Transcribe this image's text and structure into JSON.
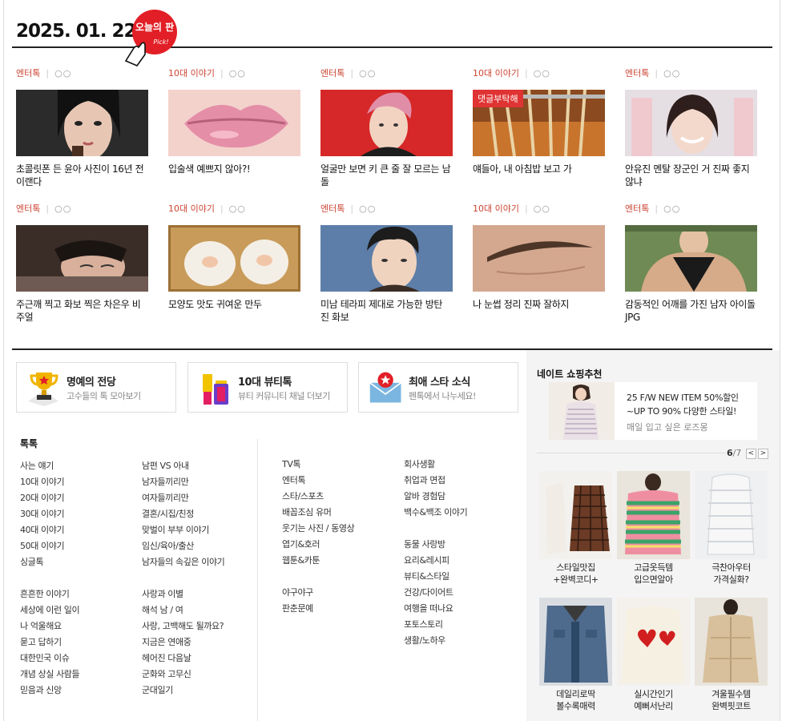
{
  "header": {
    "date": "2025. 01. 22",
    "badge_text": "오늘의 판",
    "badge_sub": "Pick!"
  },
  "cards": [
    {
      "category": "엔터톡",
      "likes": "○○",
      "title": "초콜릿폰 든 윤아 사진이 16년 전이랜다",
      "tag": ""
    },
    {
      "category": "10대 이야기",
      "likes": "○○",
      "title": "입술색 예쁘지 않아?!",
      "tag": ""
    },
    {
      "category": "엔터톡",
      "likes": "○○",
      "title": "얼굴만 보면 키 큰 줄 잘 모르는 남돌",
      "tag": ""
    },
    {
      "category": "10대 이야기",
      "likes": "○○",
      "title": "얘들아, 내 아침밥 보고 가",
      "tag": "댓글부탁해"
    },
    {
      "category": "엔터톡",
      "likes": "○○",
      "title": "안유진 멘탈 장군인 거 진짜 좋지 않냐",
      "tag": ""
    },
    {
      "category": "엔터톡",
      "likes": "○○",
      "title": "주근깨 찍고 화보 찍은 차은우 비주얼",
      "tag": ""
    },
    {
      "category": "10대 이야기",
      "likes": "○○",
      "title": "모양도 맛도 귀여운 만두",
      "tag": ""
    },
    {
      "category": "엔터톡",
      "likes": "○○",
      "title": "미남 테라피 제대로 가능한 방탄 진 화보",
      "tag": ""
    },
    {
      "category": "10대 이야기",
      "likes": "○○",
      "title": "나 눈썹 정리 진짜 잘하지",
      "tag": ""
    },
    {
      "category": "엔터톡",
      "likes": "○○",
      "title": "감동적인 어깨를 가진 남자 아이돌JPG",
      "tag": ""
    }
  ],
  "promos": [
    {
      "title": "명예의 전당",
      "sub": "고수들의 톡 모아보기",
      "icon": "trophy-icon"
    },
    {
      "title": "10대 뷰티톡",
      "sub": "뷰티 커뮤니티 채널 더보기",
      "icon": "cosmetics-icon"
    },
    {
      "title": "최애 스타 소식",
      "sub": "펜톡에서 나누세요!",
      "icon": "star-mail-icon"
    }
  ],
  "talk": {
    "title": "톡톡",
    "col1": [
      "사는 얘기",
      "10대 이야기",
      "20대 이야기",
      "30대 이야기",
      "40대 이야기",
      "50대 이야기",
      "싱글톡",
      "",
      "흔흔한 이야기",
      "세상에 이런 일이",
      "나 억울해요",
      "묻고 답하기",
      "대한민국 이슈",
      "개념 상실 사람들",
      "믿음과 신앙"
    ],
    "col2": [
      "남편 VS 아내",
      "남자들끼리만",
      "여자들끼리만",
      "결혼/시집/친정",
      "맞벌이 부부 이야기",
      "임신/육아/출산",
      "남자들의 속깊은 이야기",
      "",
      "사랑과 이별",
      "해석 남 / 여",
      "사랑, 고백해도 될까요?",
      "지금은 연애중",
      "헤어진 다음날",
      "군화와 고무신",
      "군대일기"
    ],
    "col3": [
      "TV톡",
      "엔터톡",
      "스타/스포츠",
      "배꼽조심 유머",
      "웃기는 사진 / 동영상",
      "엽기&호러",
      "웹툰&카툰",
      "",
      "야구야구",
      "판춘문예"
    ],
    "col4": [
      "회사생활",
      "취업과 면접",
      "알바 경험담",
      "백수&백조 이야기",
      "",
      "동물 사랑방",
      "요리&레시피",
      "뷰티&스타일",
      "건강/다이어트",
      "여행을 떠나요",
      "포토스토리",
      "생활/노하우"
    ]
  },
  "shopping": {
    "title": "네이트 쇼핑추천",
    "banner_line1": "25 F/W NEW ITEM 50%할인",
    "banner_line2": "~UP TO 90% 다양한 스타일!",
    "banner_sub": "매일 입고 싶은 로즈몽",
    "pager_current": "6",
    "pager_total": "/7",
    "products": [
      {
        "name1": "스타일맛집",
        "name2": "+완벽코디+"
      },
      {
        "name1": "고급옷득템",
        "name2": "입으면알아"
      },
      {
        "name1": "극찬아우터",
        "name2": "가격실화?"
      },
      {
        "name1": "데일리로딱",
        "name2": "볼수록매력"
      },
      {
        "name1": "실시간인기",
        "name2": "예뻐서난리"
      },
      {
        "name1": "겨울필수템",
        "name2": "완벽핏코트"
      }
    ]
  },
  "colors": {
    "accent": "#e03333",
    "category": "#cc4433"
  }
}
